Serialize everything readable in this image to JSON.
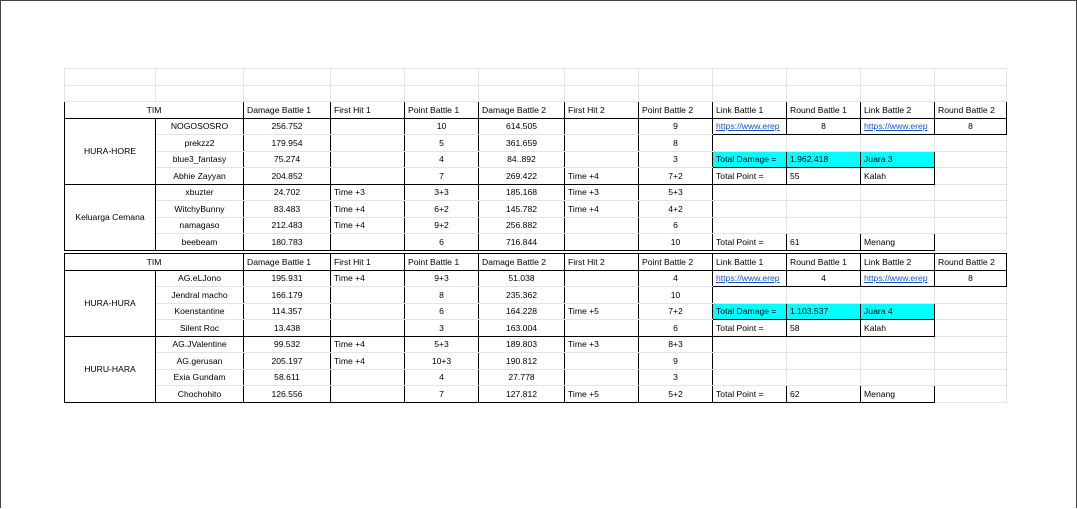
{
  "headers": [
    "TIM",
    "Damage Battle 1",
    "First Hit 1",
    "Point Battle 1",
    "Damage Battle 2",
    "First Hit 2",
    "Point Battle 2",
    "Link Battle 1",
    "Round Battle 1",
    "Link Battle 2",
    "Round Battle 2"
  ],
  "section1": {
    "teamA": {
      "name": "HURA-HORE",
      "players": [
        {
          "name": "NOGOSOSRO",
          "dmg1": "256.752",
          "fh1": "",
          "pt1": "10",
          "dmg2": "614.505",
          "fh2": "",
          "pt2": "9"
        },
        {
          "name": "prekzz2",
          "dmg1": "179.954",
          "fh1": "",
          "pt1": "5",
          "dmg2": "361.659",
          "fh2": "",
          "pt2": "8"
        },
        {
          "name": "blue3_fantasy",
          "dmg1": "75.274",
          "fh1": "",
          "pt1": "4",
          "dmg2": "84..892",
          "fh2": "",
          "pt2": "3"
        },
        {
          "name": "Abhie Zayyan",
          "dmg1": "204.852",
          "fh1": "",
          "pt1": "7",
          "dmg2": "269.422",
          "fh2": "Time +4",
          "pt2": "7+2"
        }
      ],
      "link1": "https://www.erep",
      "round1": "8",
      "link2": "https://www.erep",
      "round2": "8",
      "total_damage_label": "Total Damage =",
      "total_damage": "1.962.418",
      "result_rank": "Juara 3",
      "total_point_label": "Total Point =",
      "total_point": "55",
      "result": "Kalah"
    },
    "teamB": {
      "name": "Keluarga Cemana",
      "players": [
        {
          "name": "xbuzter",
          "dmg1": "24.702",
          "fh1": "Time +3",
          "pt1": "3+3",
          "dmg2": "185.168",
          "fh2": "Time +3",
          "pt2": "5+3"
        },
        {
          "name": "WitchyBunny",
          "dmg1": "83.483",
          "fh1": "Time +4",
          "pt1": "6+2",
          "dmg2": "145.782",
          "fh2": "Time +4",
          "pt2": "4+2"
        },
        {
          "name": "namagaso",
          "dmg1": "212.483",
          "fh1": "Time +4",
          "pt1": "9+2",
          "dmg2": "256.882",
          "fh2": "",
          "pt2": "6"
        },
        {
          "name": "beebeam",
          "dmg1": "180.783",
          "fh1": "",
          "pt1": "6",
          "dmg2": "716.844",
          "fh2": "",
          "pt2": "10"
        }
      ],
      "total_point_label": "Total Point =",
      "total_point": "61",
      "result": "Menang"
    }
  },
  "section2": {
    "teamA": {
      "name": "HURA-HURA",
      "players": [
        {
          "name": "AG.eLJono",
          "dmg1": "195.931",
          "fh1": "Time +4",
          "pt1": "9+3",
          "dmg2": "51.038",
          "fh2": "",
          "pt2": "4"
        },
        {
          "name": "Jendral macho",
          "dmg1": "166.179",
          "fh1": "",
          "pt1": "8",
          "dmg2": "235.362",
          "fh2": "",
          "pt2": "10"
        },
        {
          "name": "Koenstantine",
          "dmg1": "114.357",
          "fh1": "",
          "pt1": "6",
          "dmg2": "164.228",
          "fh2": "Time +5",
          "pt2": "7+2"
        },
        {
          "name": "Silent Roc",
          "dmg1": "13.438",
          "fh1": "",
          "pt1": "3",
          "dmg2": "163.004",
          "fh2": "",
          "pt2": "6"
        }
      ],
      "link1": "https://www.erep",
      "round1": "4",
      "link2": "https://www.erep",
      "round2": "8",
      "total_damage_label": "Total Damage =",
      "total_damage": "1.103.537",
      "result_rank": "Juara 4",
      "total_point_label": "Total Point =",
      "total_point": "58",
      "result": "Kalah"
    },
    "teamB": {
      "name": "HURU-HARA",
      "players": [
        {
          "name": "AG.JValentine",
          "dmg1": "99.532",
          "fh1": "Time +4",
          "pt1": "5+3",
          "dmg2": "189.803",
          "fh2": "Time +3",
          "pt2": "8+3"
        },
        {
          "name": "AG.gerusan",
          "dmg1": "205.197",
          "fh1": "Time +4",
          "pt1": "10+3",
          "dmg2": "190.812",
          "fh2": "",
          "pt2": "9"
        },
        {
          "name": "Exia Gundam",
          "dmg1": "58.611",
          "fh1": "",
          "pt1": "4",
          "dmg2": "27.778",
          "fh2": "",
          "pt2": "3"
        },
        {
          "name": "Chochohito",
          "dmg1": "126.556",
          "fh1": "",
          "pt1": "7",
          "dmg2": "127.812",
          "fh2": "Time +5",
          "pt2": "5+2"
        }
      ],
      "total_point_label": "Total Point =",
      "total_point": "62",
      "result": "Menang"
    }
  }
}
